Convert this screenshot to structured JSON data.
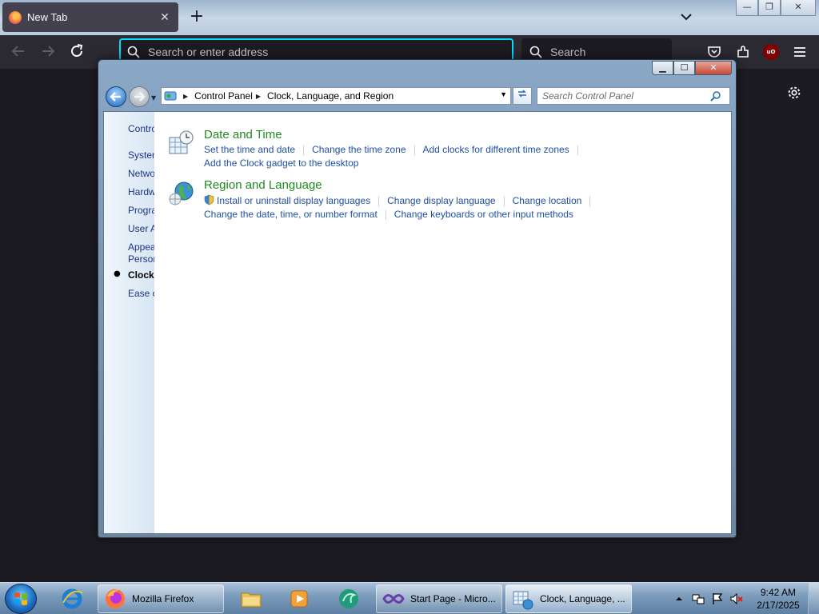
{
  "firefox": {
    "tab_title": "New Tab",
    "url_placeholder": "Search or enter address",
    "search_placeholder": "Search",
    "ublock_badge": "uO"
  },
  "window": {
    "breadcrumb": [
      "Control Panel",
      "Clock, Language, and Region"
    ],
    "search_placeholder": "Search Control Panel"
  },
  "sidebar": {
    "items": [
      {
        "label": "Contro"
      },
      {
        "label": "Systen"
      },
      {
        "label": "Netwo"
      },
      {
        "label": "Hardw"
      },
      {
        "label": "Progra"
      },
      {
        "label": "User A"
      },
      {
        "label": "Appea"
      },
      {
        "label": "Person"
      },
      {
        "label": "Clock,"
      },
      {
        "label": "Ease o"
      }
    ]
  },
  "categories": [
    {
      "title": "Date and Time",
      "links": [
        "Set the time and date",
        "Change the time zone",
        "Add clocks for different time zones",
        "Add the Clock gadget to the desktop"
      ]
    },
    {
      "title": "Region and Language",
      "links": [
        "Install or uninstall display languages",
        "Change display language",
        "Change location",
        "Change the date, time, or number format",
        "Change keyboards or other input methods"
      ]
    }
  ],
  "taskbar": {
    "tasks": [
      {
        "label": "Mozilla Firefox"
      },
      {
        "label": "Start Page - Micro..."
      },
      {
        "label": "Clock, Language, ..."
      }
    ],
    "time": "9:42 AM",
    "date": "2/17/2025"
  }
}
